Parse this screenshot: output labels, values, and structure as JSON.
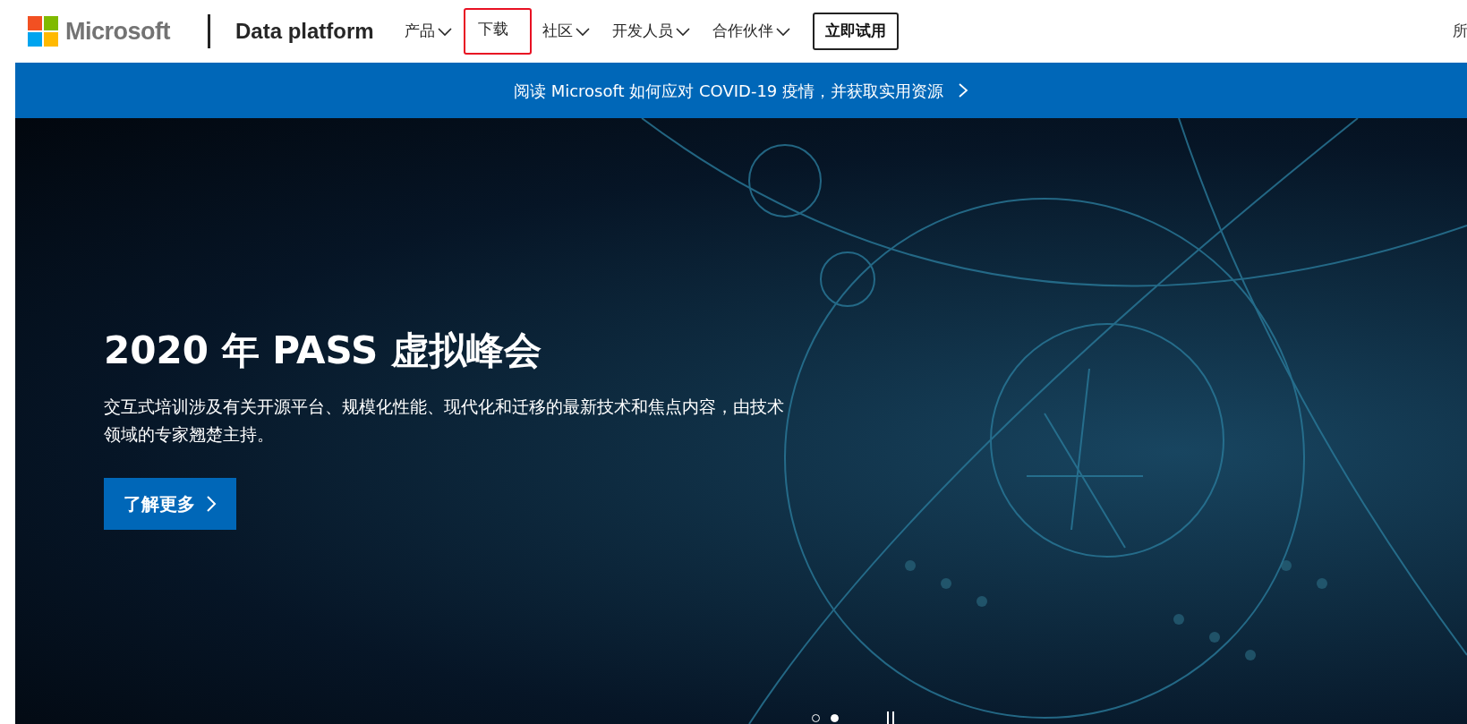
{
  "header": {
    "brand": "Microsoft",
    "site_title": "Data platform",
    "nav": [
      {
        "label": "产品",
        "kind": "dropdown",
        "highlighted": false
      },
      {
        "label": "下载",
        "kind": "link",
        "highlighted": true
      },
      {
        "label": "社区",
        "kind": "dropdown",
        "highlighted": false
      },
      {
        "label": "开发人员",
        "kind": "dropdown",
        "highlighted": false
      },
      {
        "label": "合作伙伴",
        "kind": "dropdown",
        "highlighted": false
      }
    ],
    "try_button": "立即试用",
    "cut_text": "所"
  },
  "banner": {
    "text": "阅读 Microsoft 如何应对 COVID-19 疫情，并获取实用资源"
  },
  "hero": {
    "title": "2020 年 PASS 虚拟峰会",
    "description": "交互式培训涉及有关开源平台、规模化性能、现代化和迁移的最新技术和焦点内容，由技术领域的专家翘楚主持。",
    "button": "了解更多",
    "slides": [
      {
        "selected": false
      },
      {
        "selected": true
      }
    ]
  }
}
